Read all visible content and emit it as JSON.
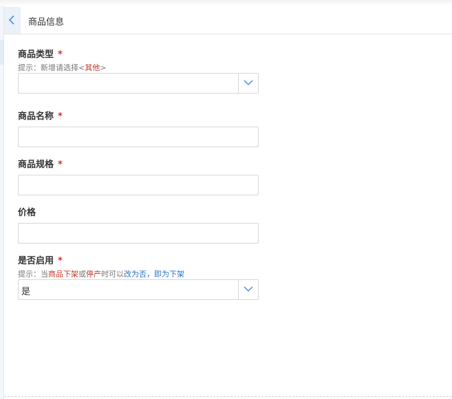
{
  "header": {
    "title": "商品信息"
  },
  "fields": {
    "type": {
      "label": "商品类型",
      "required_mark": "*",
      "hint_prefix": "提示：新增请选择<",
      "hint_other": "其他",
      "hint_suffix": ">",
      "value": ""
    },
    "name": {
      "label": "商品名称",
      "required_mark": "*",
      "value": ""
    },
    "spec": {
      "label": "商品规格",
      "required_mark": "*",
      "value": ""
    },
    "price": {
      "label": "价格",
      "value": ""
    },
    "enabled": {
      "label": "是否启用",
      "required_mark": "*",
      "hint_1": "提示：当",
      "hint_2": "商品下架",
      "hint_3": "或",
      "hint_4": "停产",
      "hint_5": "时可以",
      "hint_6": "改为否，即为下架",
      "value": "是"
    }
  },
  "colors": {
    "required": "#d0342c",
    "hint_red": "#c0392b",
    "hint_blue": "#2a73c2",
    "arrow": "#4a90d9"
  },
  "icons": {
    "back": "chevron-left-icon",
    "dropdown": "chevron-down-icon"
  }
}
